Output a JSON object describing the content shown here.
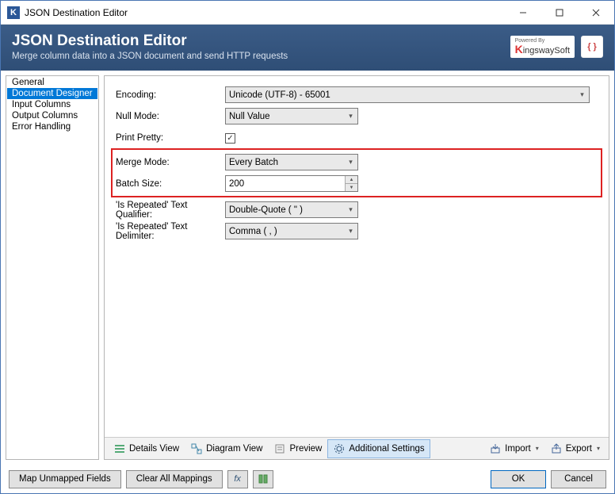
{
  "window": {
    "app_icon_letter": "K",
    "title": "JSON Destination Editor"
  },
  "banner": {
    "heading": "JSON Destination Editor",
    "subtext": "Merge column data into a JSON document and send HTTP requests",
    "powered_by": "Powered By",
    "brand": "ingswaySoft",
    "json_badge": "{ }"
  },
  "sidebar": {
    "items": [
      {
        "label": "General",
        "selected": false
      },
      {
        "label": "Document Designer",
        "selected": true
      },
      {
        "label": "Input Columns",
        "selected": false
      },
      {
        "label": "Output Columns",
        "selected": false
      },
      {
        "label": "Error Handling",
        "selected": false
      }
    ]
  },
  "settings": {
    "encoding": {
      "label": "Encoding:",
      "value": "Unicode (UTF-8) - 65001"
    },
    "null_mode": {
      "label": "Null Mode:",
      "value": "Null Value"
    },
    "print_pretty": {
      "label": "Print Pretty:",
      "checked": true
    },
    "merge_mode": {
      "label": "Merge Mode:",
      "value": "Every Batch"
    },
    "batch_size": {
      "label": "Batch Size:",
      "value": "200"
    },
    "qualifier": {
      "label": "'Is Repeated' Text Qualifier:",
      "value": "Double-Quote ( \" )"
    },
    "delimiter": {
      "label": "'Is Repeated' Text Delimiter:",
      "value": "Comma ( , )"
    }
  },
  "toolbar": {
    "details": "Details View",
    "diagram": "Diagram View",
    "preview": "Preview",
    "additional": "Additional Settings",
    "import": "Import",
    "export": "Export"
  },
  "footer": {
    "map_unmapped": "Map Unmapped Fields",
    "clear_all": "Clear All Mappings",
    "ok": "OK",
    "cancel": "Cancel"
  }
}
